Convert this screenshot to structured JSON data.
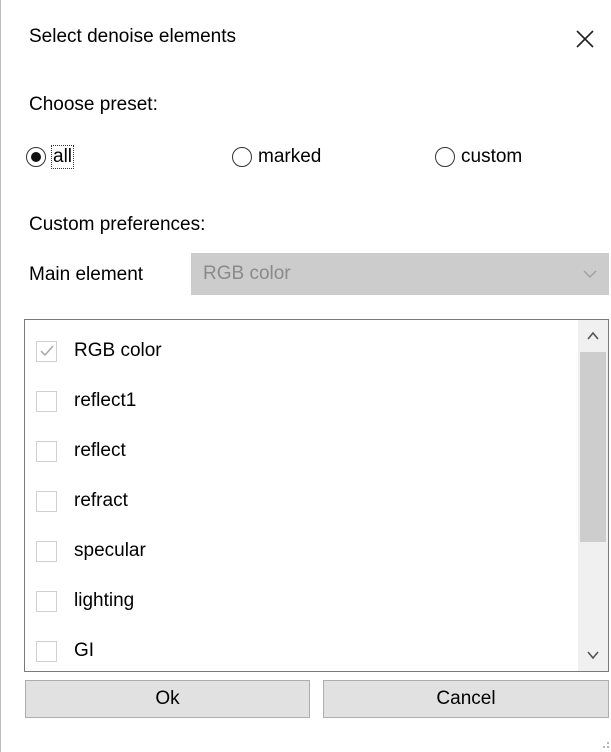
{
  "dialog": {
    "title": "Select denoise elements"
  },
  "preset": {
    "label": "Choose preset:",
    "options": [
      {
        "label": "all",
        "selected": true
      },
      {
        "label": "marked",
        "selected": false
      },
      {
        "label": "custom",
        "selected": false
      }
    ]
  },
  "custom": {
    "label": "Custom preferences:",
    "main_element_label": "Main element",
    "main_element_value": "RGB color",
    "main_element_enabled": false
  },
  "elements": [
    {
      "label": "RGB color",
      "checked": true,
      "disabled": true
    },
    {
      "label": "reflect1",
      "checked": false
    },
    {
      "label": "reflect",
      "checked": false
    },
    {
      "label": "refract",
      "checked": false
    },
    {
      "label": "specular",
      "checked": false
    },
    {
      "label": "lighting",
      "checked": false
    },
    {
      "label": "GI",
      "checked": false
    }
  ],
  "buttons": {
    "ok": "Ok",
    "cancel": "Cancel"
  },
  "icons": {
    "close": "close-icon",
    "dropdown": "chevron-down-icon",
    "scroll_up": "chevron-up-icon",
    "scroll_down": "chevron-down-icon",
    "check": "checkmark-icon"
  },
  "colors": {
    "disabled_fill": "#cccccc",
    "disabled_text": "#8a8a8a",
    "button_fill": "#e1e1e1",
    "scroll_thumb": "#cdcdcd"
  }
}
